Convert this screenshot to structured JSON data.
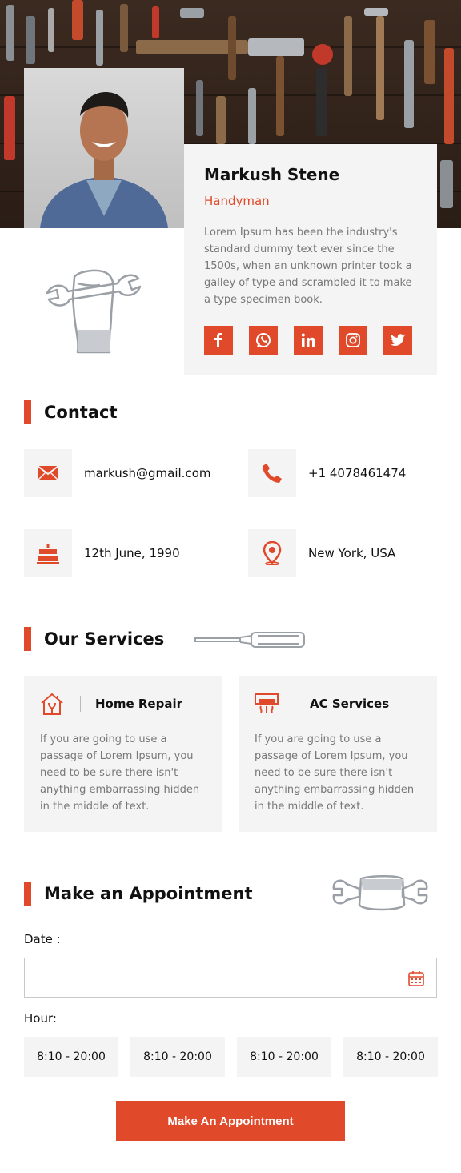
{
  "profile": {
    "name": "Markush Stene",
    "role": "Handyman",
    "bio": "Lorem Ipsum has been the industry's standard dummy text ever since the 1500s, when an unknown printer took a galley of type and scrambled it to make a type specimen book.",
    "socials": [
      "facebook-icon",
      "whatsapp-icon",
      "linkedin-icon",
      "instagram-icon",
      "twitter-icon"
    ]
  },
  "contact": {
    "title": "Contact",
    "email": "markush@gmail.com",
    "phone": "+1 4078461474",
    "birthday": "12th June, 1990",
    "location": "New York, USA"
  },
  "services": {
    "title": "Our Services",
    "items": [
      {
        "title": "Home Repair",
        "icon": "home-repair-icon",
        "desc": "If you are going to use a passage of Lorem Ipsum, you need to be sure there isn't anything embarrassing hidden in the middle of text."
      },
      {
        "title": "AC Services",
        "icon": "ac-unit-icon",
        "desc": "If you are going to use a passage of Lorem Ipsum, you need to be sure there isn't anything embarrassing hidden in the middle of text."
      }
    ]
  },
  "appointment": {
    "title": "Make an Appointment",
    "date_label": "Date :",
    "date_value": "",
    "hour_label": "Hour:",
    "hours": [
      "8:10 - 20:00",
      "8:10 - 20:00",
      "8:10 - 20:00",
      "8:10 - 20:00"
    ],
    "button": "Make An Appointment"
  },
  "colors": {
    "accent": "#e04a2a",
    "panel": "#f4f4f4",
    "muted_text": "#777777"
  }
}
